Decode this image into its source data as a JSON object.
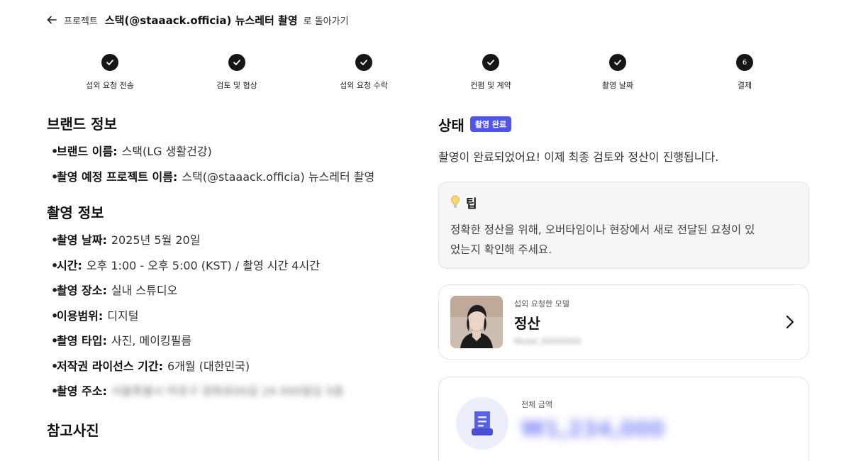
{
  "topbar": {
    "prefix": "프로젝트",
    "title": "스택(@staaack.officia) 뉴스레터 촬영",
    "suffix": "로 돌아가기"
  },
  "steps": [
    {
      "label": "섭외 요청 전송",
      "status": "done"
    },
    {
      "label": "검토 및 협상",
      "status": "done"
    },
    {
      "label": "섭외 요청 수락",
      "status": "done"
    },
    {
      "label": "컨펌 및 계약",
      "status": "done"
    },
    {
      "label": "촬영 날짜",
      "status": "done"
    },
    {
      "label": "결제",
      "status": "current",
      "number": "6"
    }
  ],
  "brand_section": {
    "title": "브랜드 정보",
    "items": [
      {
        "key": "브랜드 이름:",
        "value": "스택(LG 생활건강)"
      },
      {
        "key": "촬영 예정 프로젝트 이름:",
        "value": "스택(@staaack.officia) 뉴스레터 촬영"
      }
    ]
  },
  "shoot_section": {
    "title": "촬영 정보",
    "items": [
      {
        "key": "촬영 날짜:",
        "value": "2025년 5월 20일"
      },
      {
        "key": "시간:",
        "value": "오후 1:00 - 오후 5:00 (KST) / 촬영 시간 4시간"
      },
      {
        "key": "촬영 장소:",
        "value": "실내 스튜디오"
      },
      {
        "key": "이용범위:",
        "value": "디지털"
      },
      {
        "key": "촬영 타입:",
        "value": "사진, 메이킹필름"
      },
      {
        "key": "저작권 라이선스 기간:",
        "value": "6개월 (대한민국)"
      },
      {
        "key": "촬영 주소:",
        "value": "서울특별시 마포구 양화로00길 24 000빌딩 5층"
      }
    ]
  },
  "reference_section": {
    "title": "참고사진"
  },
  "status": {
    "title": "상태",
    "badge": "촬영 완료",
    "description": "촬영이 완료되었어요! 이제 최종 검토와 정산이 진행됩니다."
  },
  "tip": {
    "title": "팁",
    "line1": "정확한 정산을 위해, 오버타임이나 현장에서 새로 전달된 요청이 있",
    "line2": "었는지 확인해 주세요."
  },
  "model_card": {
    "caption": "섭외 요청한 모델",
    "name": "정산",
    "id_text": "Model_00000000"
  },
  "amount_card": {
    "caption": "전체 금액",
    "value": "₩1,234,000"
  },
  "colors": {
    "accent": "#4f55e8",
    "step_dot": "#161616",
    "amount_icon_bg": "#eceefc"
  }
}
